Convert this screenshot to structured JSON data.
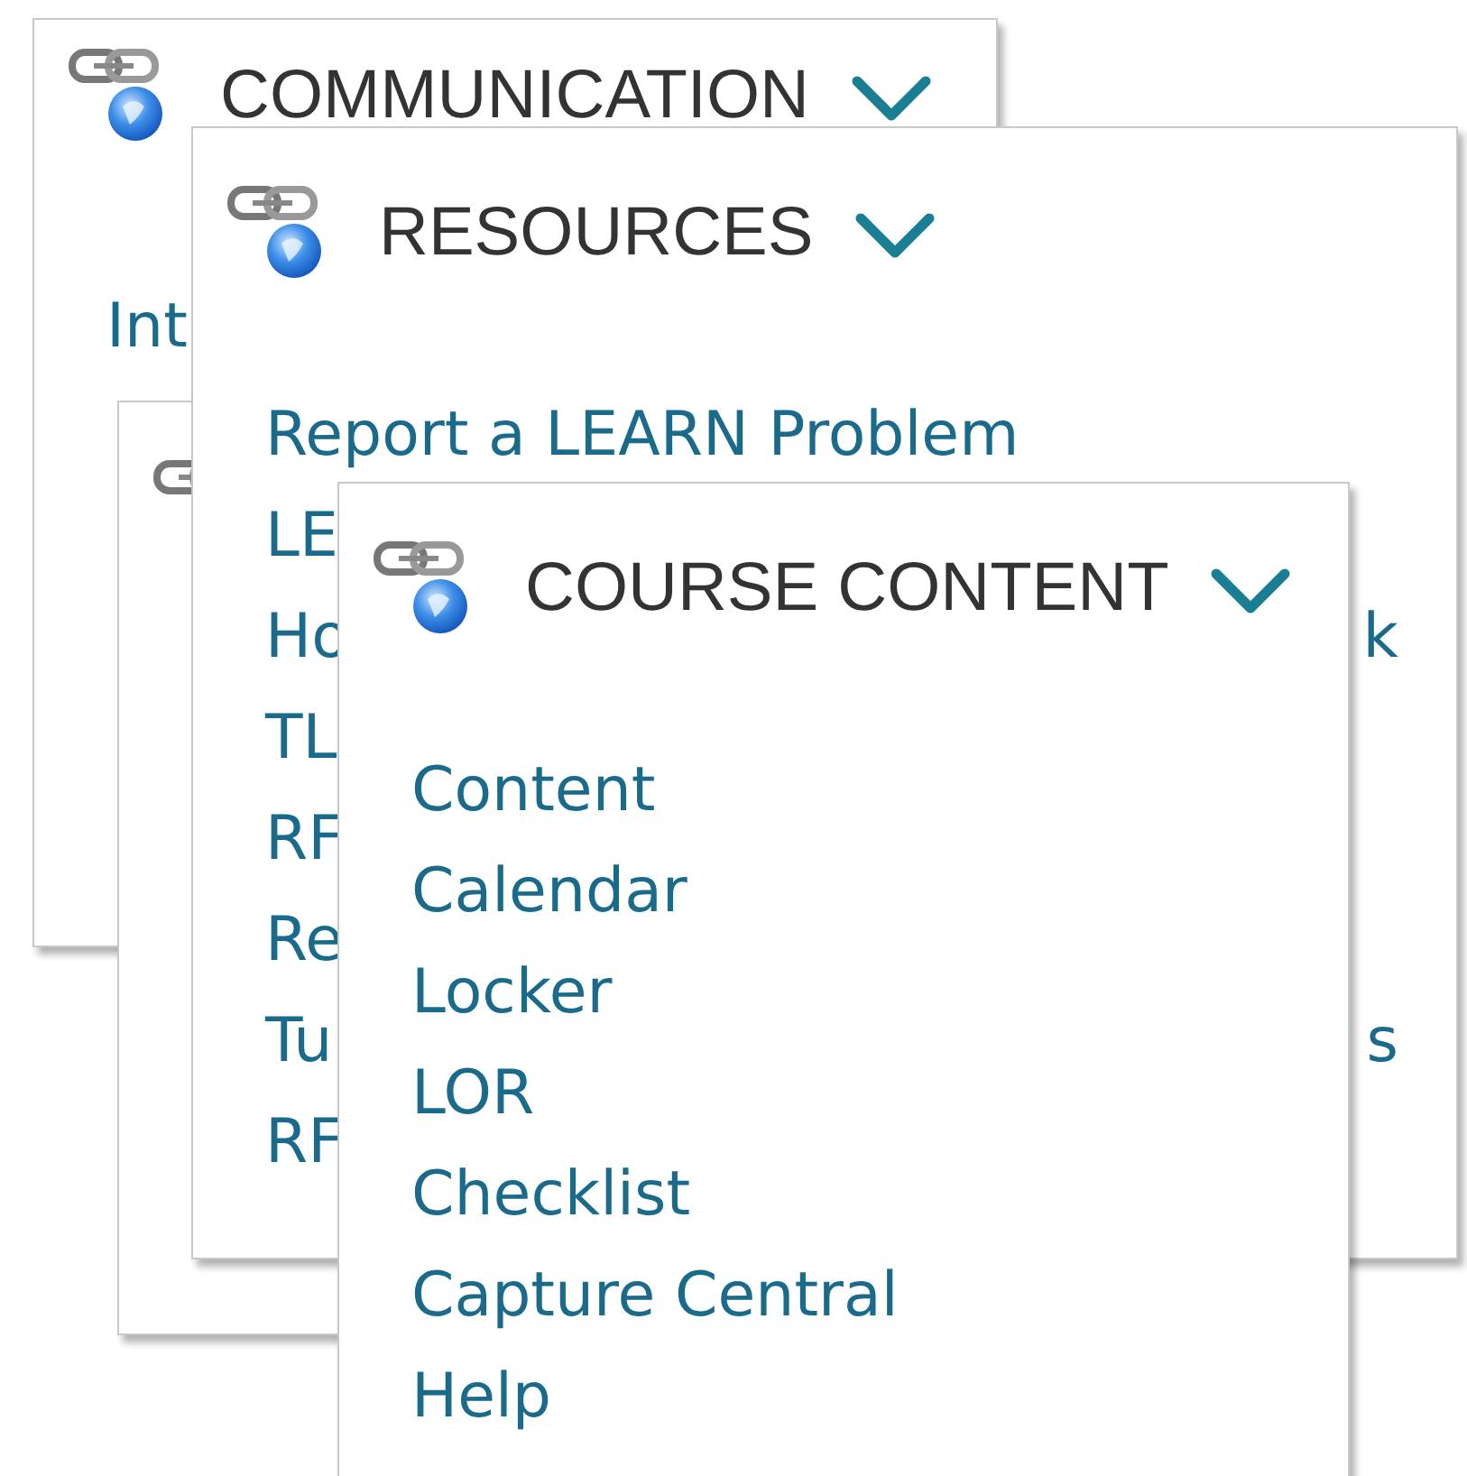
{
  "menus": [
    {
      "kind": "menu",
      "title": "COMMUNICATION",
      "items": [
        {
          "text": "Int"
        }
      ]
    },
    {
      "kind": "covered"
    },
    {
      "kind": "menu",
      "title": "RESOURCES",
      "items": [
        {
          "text": "Report a LEARN Problem"
        },
        {
          "text": "LE"
        },
        {
          "text": "Ho",
          "text_end": "k"
        },
        {
          "text": "TL"
        },
        {
          "text": "RF"
        },
        {
          "text": "Re"
        },
        {
          "text": "Tu",
          "text_end": "s"
        },
        {
          "text": "RF"
        }
      ]
    },
    {
      "kind": "menu",
      "title": "COURSE CONTENT",
      "items": [
        {
          "text": "Content"
        },
        {
          "text": "Calendar"
        },
        {
          "text": "Locker"
        },
        {
          "text": "LOR"
        },
        {
          "text": "Checklist"
        },
        {
          "text": "Capture Central"
        },
        {
          "text": "Help"
        }
      ]
    }
  ]
}
